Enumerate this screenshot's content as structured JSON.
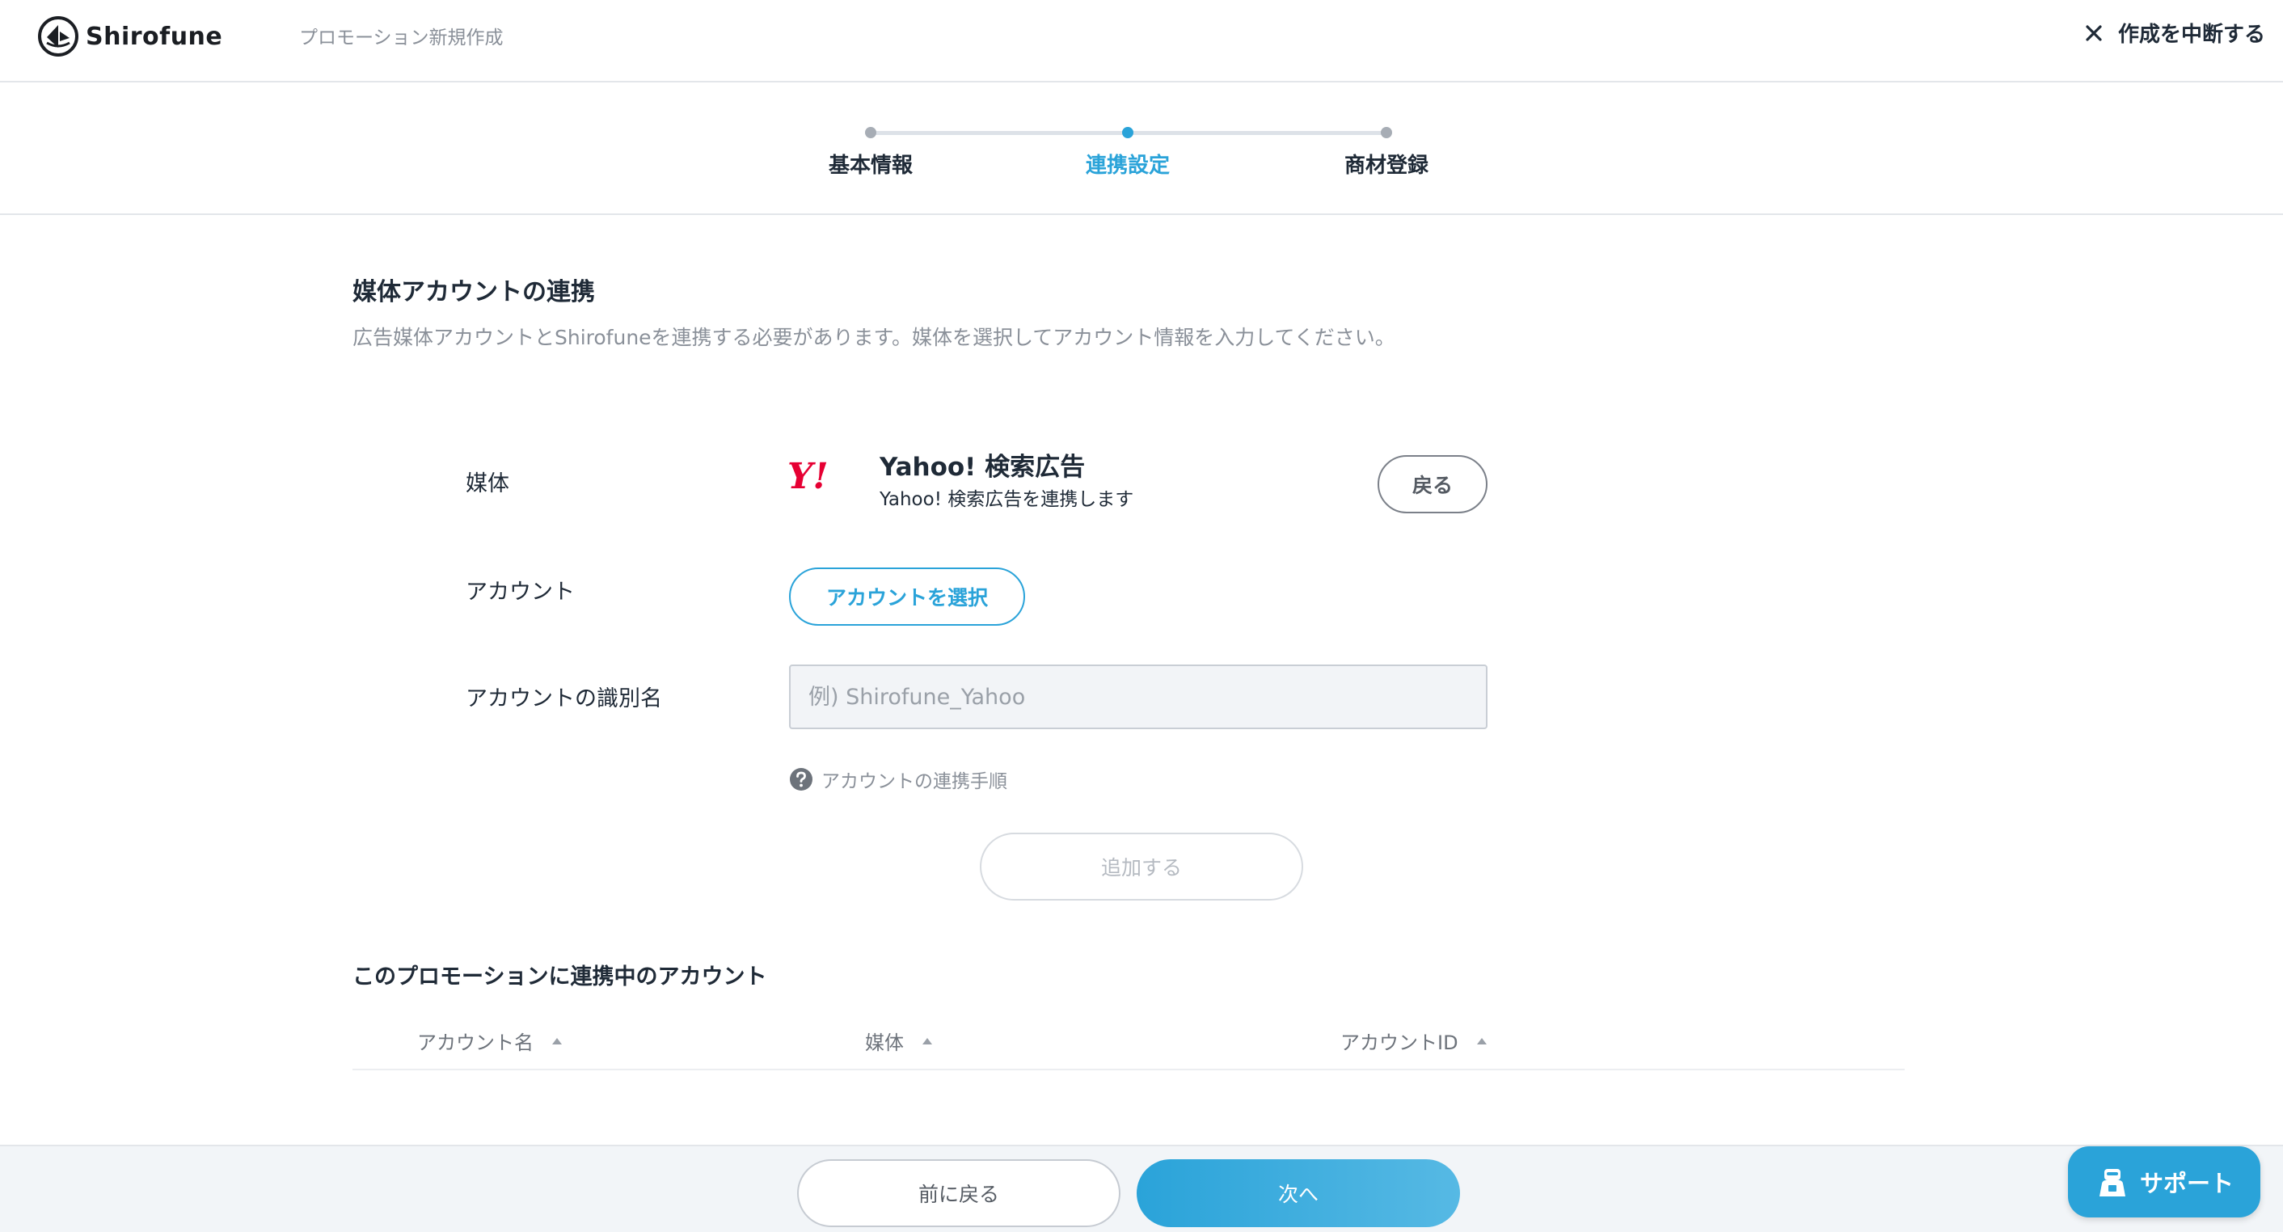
{
  "header": {
    "logo_text": "Shirofune",
    "page_title": "プロモーション新規作成",
    "abort_label": "作成を中断する"
  },
  "stepper": {
    "steps": [
      {
        "label": "基本情報",
        "active": false
      },
      {
        "label": "連携設定",
        "active": true
      },
      {
        "label": "商材登録",
        "active": false
      }
    ]
  },
  "section": {
    "title": "媒体アカウントの連携",
    "description": "広告媒体アカウントとShirofuneを連携する必要があります。媒体を選択してアカウント情報を入力してください。"
  },
  "form": {
    "media_label": "媒体",
    "media_logo": "Y!",
    "media_name": "Yahoo! 検索広告",
    "media_sub": "Yahoo! 検索広告を連携します",
    "back_label": "戻る",
    "account_label": "アカウント",
    "select_account_label": "アカウントを選択",
    "account_name_label": "アカウントの識別名",
    "account_name_value": "",
    "account_name_placeholder": "例) Shirofune_Yahoo",
    "help_label": "アカウントの連携手順",
    "add_label": "追加する"
  },
  "table": {
    "title": "このプロモーションに連携中のアカウント",
    "columns": [
      "アカウント名",
      "媒体",
      "アカウントID"
    ]
  },
  "footer": {
    "prev_label": "前に戻る",
    "next_label": "次へ"
  },
  "support": {
    "label": "サポート"
  },
  "colors": {
    "accent": "#2aa3d9",
    "yahoo_red": "#e60033"
  }
}
